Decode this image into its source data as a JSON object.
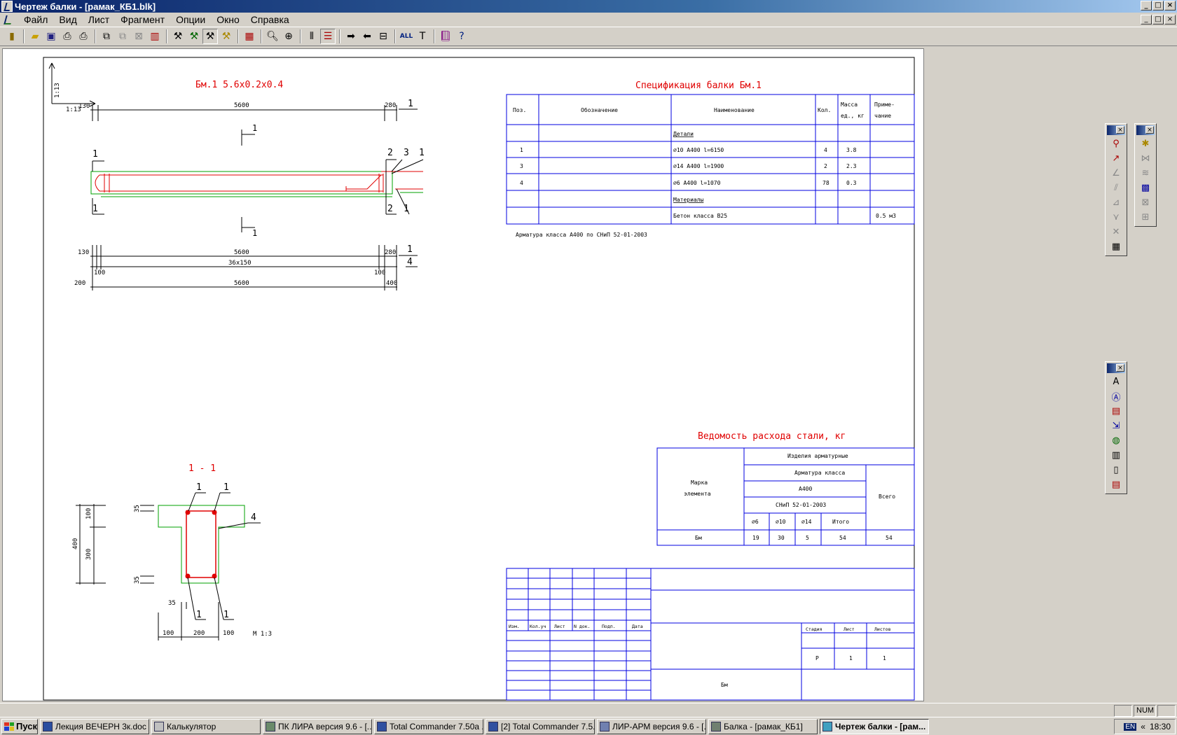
{
  "window": {
    "title": "Чертеж балки - [рамак_КБ1.blk]",
    "controls": [
      "_",
      "□",
      "×"
    ]
  },
  "menu": [
    "Файл",
    "Вид",
    "Лист",
    "Фрагмент",
    "Опции",
    "Окно",
    "Справка"
  ],
  "drawing": {
    "beam_title": "Бм.1 5.6х0.2х0.4",
    "scale_small": "1:13",
    "dims_top": {
      "left": "130",
      "main": "5600",
      "right": "280"
    },
    "dims_bottom": {
      "left1": "130",
      "main1": "5600",
      "right1": "280",
      "left2": "100",
      "spacing": "36х150",
      "right2": "100",
      "left3": "200",
      "main3": "5600",
      "right3": "400"
    },
    "marks": {
      "pos1": "1",
      "pos2": "2",
      "pos3": "3",
      "pos4": "4",
      "section": "1"
    },
    "section_title": "1 - 1",
    "section_dims": {
      "h_total": "400",
      "h_top": "100",
      "h_mid": "300",
      "cover_top": "35",
      "cover_bot": "35",
      "cover_side": "35",
      "w_left": "100",
      "w_mid": "200",
      "w_right": "100",
      "scale": "М 1:3"
    },
    "spec": {
      "title": "Спецификация балки Бм.1",
      "headers": [
        "Поз.",
        "Обозначение",
        "Наименование",
        "Кол.",
        "Масса ед., кг",
        "Приме-чание"
      ],
      "group1": "Детали",
      "rows": [
        {
          "pos": "1",
          "name": "⌀10 А400 l=6150",
          "qty": "4",
          "mass": "3.8"
        },
        {
          "pos": "3",
          "name": "⌀14 А400 l=1900",
          "qty": "2",
          "mass": "2.3"
        },
        {
          "pos": "4",
          "name": "⌀6 А400 l=1070",
          "qty": "78",
          "mass": "0.3"
        }
      ],
      "group2": "Материалы",
      "material": {
        "name": "Бетон класса В25",
        "note": "0.5 м3"
      },
      "footnote": "Арматура класса А400 по СНиП 52-01-2003"
    },
    "steel": {
      "title": "Ведомость расхода стали, кг",
      "mark_header": "Марка элемента",
      "h1": "Изделия арматурные",
      "h2": "Арматура класса",
      "h3": "А400",
      "h4": "СНиП 52-01-2003",
      "total_header": "Всего",
      "cols": [
        "⌀6",
        "⌀10",
        "⌀14",
        "Итого"
      ],
      "row": {
        "mark": "Бм",
        "v1": "19",
        "v2": "30",
        "v3": "5",
        "sum": "54",
        "total": "54"
      }
    },
    "stamp": {
      "cols": [
        "Изм.",
        "Кол.уч",
        "Лист",
        "N док.",
        "Подп.",
        "Дата"
      ],
      "stage_header": "Стадия",
      "sheet_header": "Лист",
      "sheets_header": "Листов",
      "stage": "Р",
      "sheet": "1",
      "sheets": "1",
      "name": "Бм"
    }
  },
  "statusbar": {
    "num": "NUM"
  },
  "taskbar": {
    "start": "Пуск",
    "tasks": [
      "Лекция ВЕЧЕРН 3к.doc ...",
      "Калькулятор",
      "ПК ЛИРА  версия 9.6 - [...",
      "Total Commander 7.50a ...",
      "[2] Total Commander 7.5...",
      "ЛИР-АРМ версия 9.6  - [...",
      "Балка - [рамак_КБ1]",
      "Чертеж балки - [рам..."
    ],
    "lang": "EN",
    "clock": "18:30",
    "chevron": "«"
  }
}
